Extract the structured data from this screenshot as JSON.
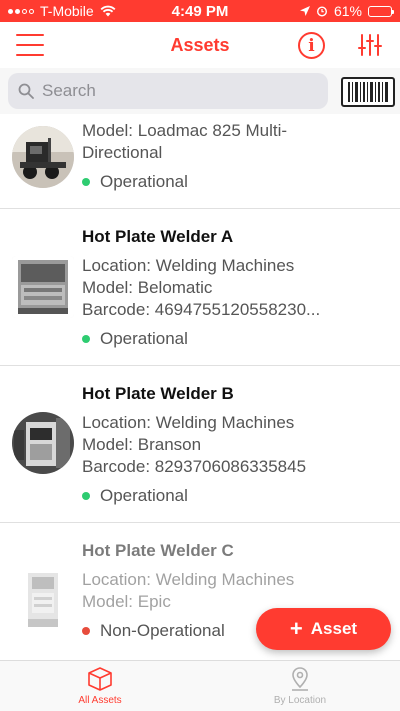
{
  "status_bar": {
    "carrier": "T-Mobile",
    "time": "4:49 PM",
    "battery": "61%",
    "battery_fraction": 0.61
  },
  "nav": {
    "title": "Assets",
    "info_icon": "info-icon",
    "menu_icon": "menu-icon",
    "filter_icon": "filter-icon"
  },
  "search": {
    "placeholder": "Search",
    "value": "",
    "barcode_icon": "barcode-icon"
  },
  "assets": [
    {
      "name": "",
      "line1": "Model: Loadmac 825 Multi-",
      "line2": "Directional",
      "status": "Operational",
      "status_color": "#2ecc71"
    },
    {
      "name": "Hot Plate Welder A",
      "line1": "Location: Welding Machines",
      "line2": "Model: Belomatic",
      "line3": "Barcode: 4694755120558230...",
      "status": "Operational",
      "status_color": "#2ecc71"
    },
    {
      "name": "Hot Plate Welder B",
      "line1": "Location: Welding Machines",
      "line2": "Model: Branson",
      "line3": "Barcode: 8293706086335845",
      "status": "Operational",
      "status_color": "#2ecc71"
    },
    {
      "name": "Hot Plate Welder C",
      "line1": "Location: Welding Machines",
      "line2": "Model: Epic",
      "status": "Non-Operational",
      "status_color": "#e74c3c"
    }
  ],
  "fab": {
    "label": "Asset",
    "plus": "+"
  },
  "tabs": [
    {
      "label": "All Assets",
      "icon": "box-icon",
      "active": true
    },
    {
      "label": "By Location",
      "icon": "location-pin-icon",
      "active": false
    }
  ],
  "colors": {
    "accent": "#ff3b30",
    "operational": "#2ecc71",
    "non_operational": "#e74c3c"
  }
}
